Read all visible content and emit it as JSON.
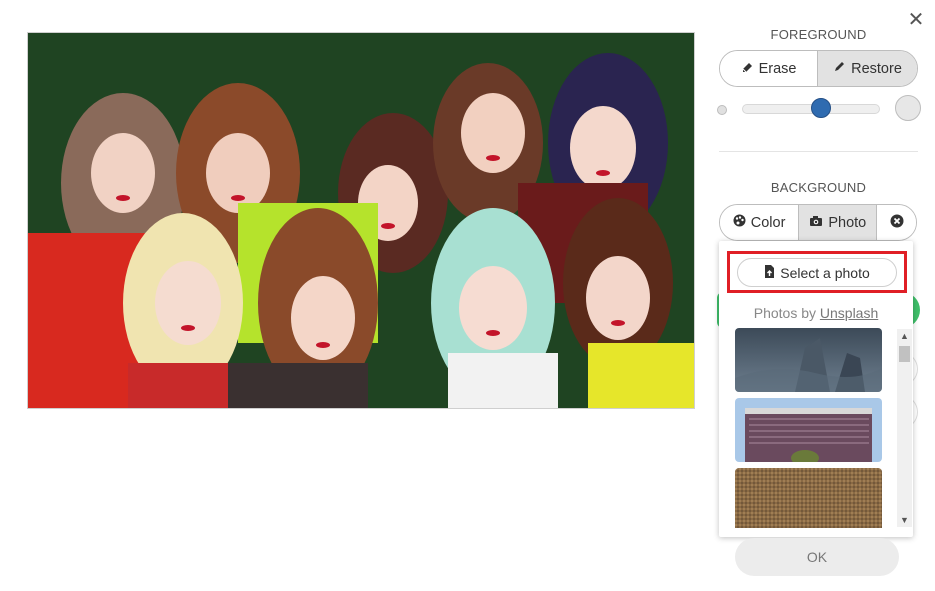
{
  "dialog": {
    "close_symbol": "✕"
  },
  "foreground": {
    "title": "FOREGROUND",
    "erase_label": "Erase",
    "restore_label": "Restore",
    "active": "restore",
    "brush_size_fraction": 0.57
  },
  "background": {
    "title": "BACKGROUND",
    "color_label": "Color",
    "photo_label": "Photo",
    "active": "photo"
  },
  "photo_picker": {
    "select_label": "Select a photo",
    "credit_prefix": "Photos by",
    "credit_link": "Unsplash",
    "thumbnails": [
      "city-skyscraper-photo",
      "hotel-building-photo",
      "burlap-texture-photo"
    ]
  },
  "ok_label": "OK",
  "colors": {
    "canvas_bg": "#1f4422",
    "slider_thumb": "#2f6bb0",
    "highlight": "#e01f26"
  }
}
